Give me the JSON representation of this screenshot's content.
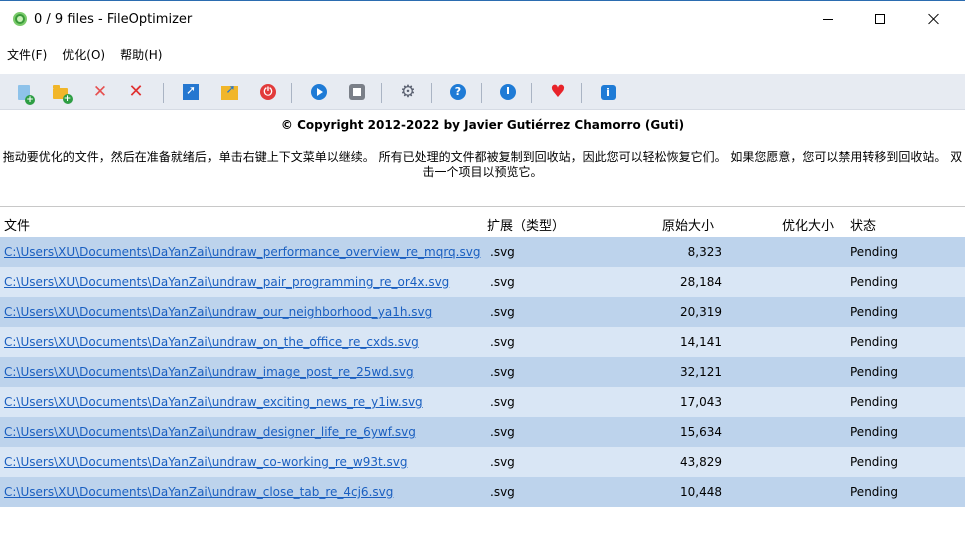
{
  "window": {
    "title": "0 / 9 files - FileOptimizer"
  },
  "menu": [
    {
      "label": "文件(F)"
    },
    {
      "label": "优化(O)"
    },
    {
      "label": "帮助(H)"
    }
  ],
  "toolbar": {
    "buttons": [
      {
        "icon": "add-files-icon"
      },
      {
        "icon": "add-folder-icon"
      },
      {
        "icon": "remove-file-icon"
      },
      {
        "icon": "clear-list-icon"
      },
      {
        "icon": "open-icon"
      },
      {
        "icon": "open-folder-icon"
      },
      {
        "icon": "exit-icon"
      },
      {
        "icon": "optimize-icon"
      },
      {
        "icon": "stop-icon"
      },
      {
        "icon": "settings-icon"
      },
      {
        "icon": "help-icon"
      },
      {
        "icon": "check-updates-icon"
      },
      {
        "icon": "donate-heart-icon"
      },
      {
        "icon": "about-icon"
      }
    ]
  },
  "copyright": "© Copyright 2012-2022 by Javier Gutiérrez Chamorro (Guti)",
  "instructions": "拖动要优化的文件，然后在准备就绪后，单击右键上下文菜单以继续。 所有已处理的文件都被复制到回收站，因此您可以轻松恢复它们。 如果您愿意，您可以禁用转移到回收站。 双击一个项目以预览它。",
  "table": {
    "columns": {
      "file": "文件",
      "ext": "扩展（类型）",
      "original": "原始大小",
      "optimized": "优化大小",
      "status": "状态"
    },
    "rows": [
      {
        "file": "C:\\Users\\XU\\Documents\\DaYanZai\\undraw_performance_overview_re_mqrq.svg",
        "ext": ".svg",
        "original": "8,323",
        "optimized": "",
        "status": "Pending"
      },
      {
        "file": "C:\\Users\\XU\\Documents\\DaYanZai\\undraw_pair_programming_re_or4x.svg",
        "ext": ".svg",
        "original": "28,184",
        "optimized": "",
        "status": "Pending"
      },
      {
        "file": "C:\\Users\\XU\\Documents\\DaYanZai\\undraw_our_neighborhood_ya1h.svg",
        "ext": ".svg",
        "original": "20,319",
        "optimized": "",
        "status": "Pending"
      },
      {
        "file": "C:\\Users\\XU\\Documents\\DaYanZai\\undraw_on_the_office_re_cxds.svg",
        "ext": ".svg",
        "original": "14,141",
        "optimized": "",
        "status": "Pending"
      },
      {
        "file": "C:\\Users\\XU\\Documents\\DaYanZai\\undraw_image_post_re_25wd.svg",
        "ext": ".svg",
        "original": "32,121",
        "optimized": "",
        "status": "Pending"
      },
      {
        "file": "C:\\Users\\XU\\Documents\\DaYanZai\\undraw_exciting_news_re_y1iw.svg",
        "ext": ".svg",
        "original": "17,043",
        "optimized": "",
        "status": "Pending"
      },
      {
        "file": "C:\\Users\\XU\\Documents\\DaYanZai\\undraw_designer_life_re_6ywf.svg",
        "ext": ".svg",
        "original": "15,634",
        "optimized": "",
        "status": "Pending"
      },
      {
        "file": "C:\\Users\\XU\\Documents\\DaYanZai\\undraw_co-working_re_w93t.svg",
        "ext": ".svg",
        "original": "43,829",
        "optimized": "",
        "status": "Pending"
      },
      {
        "file": "C:\\Users\\XU\\Documents\\DaYanZai\\undraw_close_tab_re_4cj6.svg",
        "ext": ".svg",
        "original": "10,448",
        "optimized": "",
        "status": "Pending"
      }
    ]
  }
}
